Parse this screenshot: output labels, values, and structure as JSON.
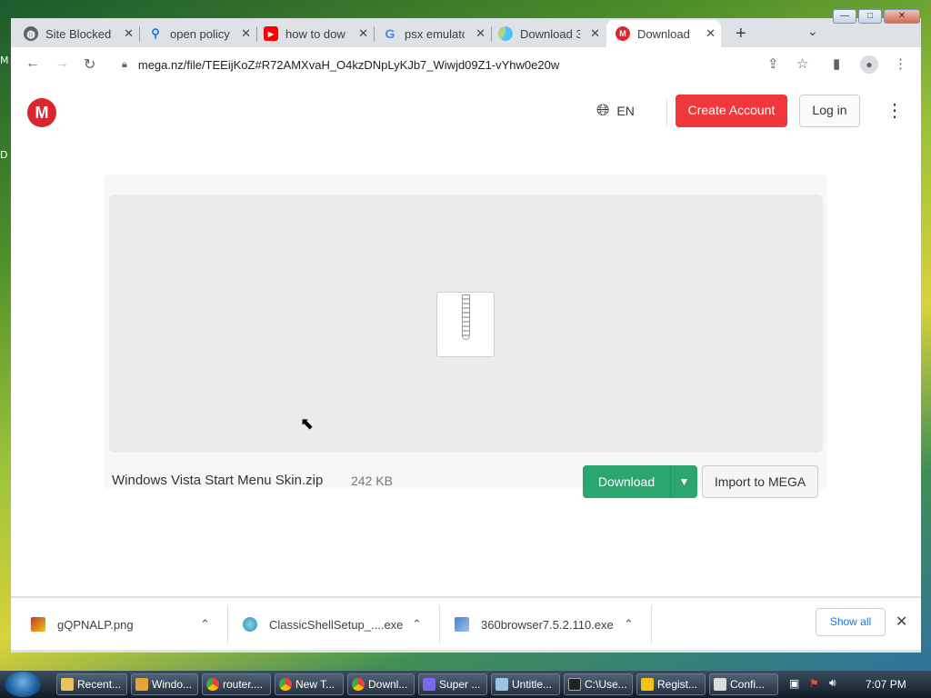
{
  "desktop": {
    "labels": [
      "M",
      "D"
    ]
  },
  "window_controls": {
    "minimize": "—",
    "maximize": "□",
    "close": "✕"
  },
  "tabs": [
    {
      "title": "Site Blocked",
      "icon": "globe-icon"
    },
    {
      "title": "open policy",
      "icon": "search-icon"
    },
    {
      "title": "how to dow",
      "icon": "youtube-icon"
    },
    {
      "title": "psx emulato",
      "icon": "google-icon"
    },
    {
      "title": "Download 3",
      "icon": "download-site-icon"
    },
    {
      "title": "Download",
      "icon": "mega-icon",
      "active": true
    }
  ],
  "toolbar": {
    "url": "mega.nz/file/TEEijKoZ#R72AMXvaH_O4kzDNpLyKJb7_Wiwjd09Z1-vYhw0e20w"
  },
  "mega": {
    "logo_letter": "M",
    "language": "EN",
    "create_account": "Create Account",
    "login": "Log in"
  },
  "file": {
    "name": "Windows Vista Start Menu Skin.zip",
    "size": "242 KB",
    "download_label": "Download",
    "import_label": "Import to MEGA"
  },
  "downloads": {
    "items": [
      {
        "name": "gQPNALP.png"
      },
      {
        "name": "ClassicShellSetup_....exe"
      },
      {
        "name": "360browser7.5.2.110.exe"
      }
    ],
    "show_all": "Show all"
  },
  "taskbar": {
    "tasks": [
      "Recent...",
      "Windo...",
      "router....",
      "New T...",
      "Downl...",
      "Super ...",
      "Untitle...",
      "C:\\Use...",
      "Regist...",
      "Confi..."
    ],
    "clock": "7:07 PM"
  },
  "colors": {
    "mega_red": "#d9272e",
    "create_account": "#f0373a",
    "download_green": "#2ba66f",
    "link_blue": "#1a73e8"
  }
}
